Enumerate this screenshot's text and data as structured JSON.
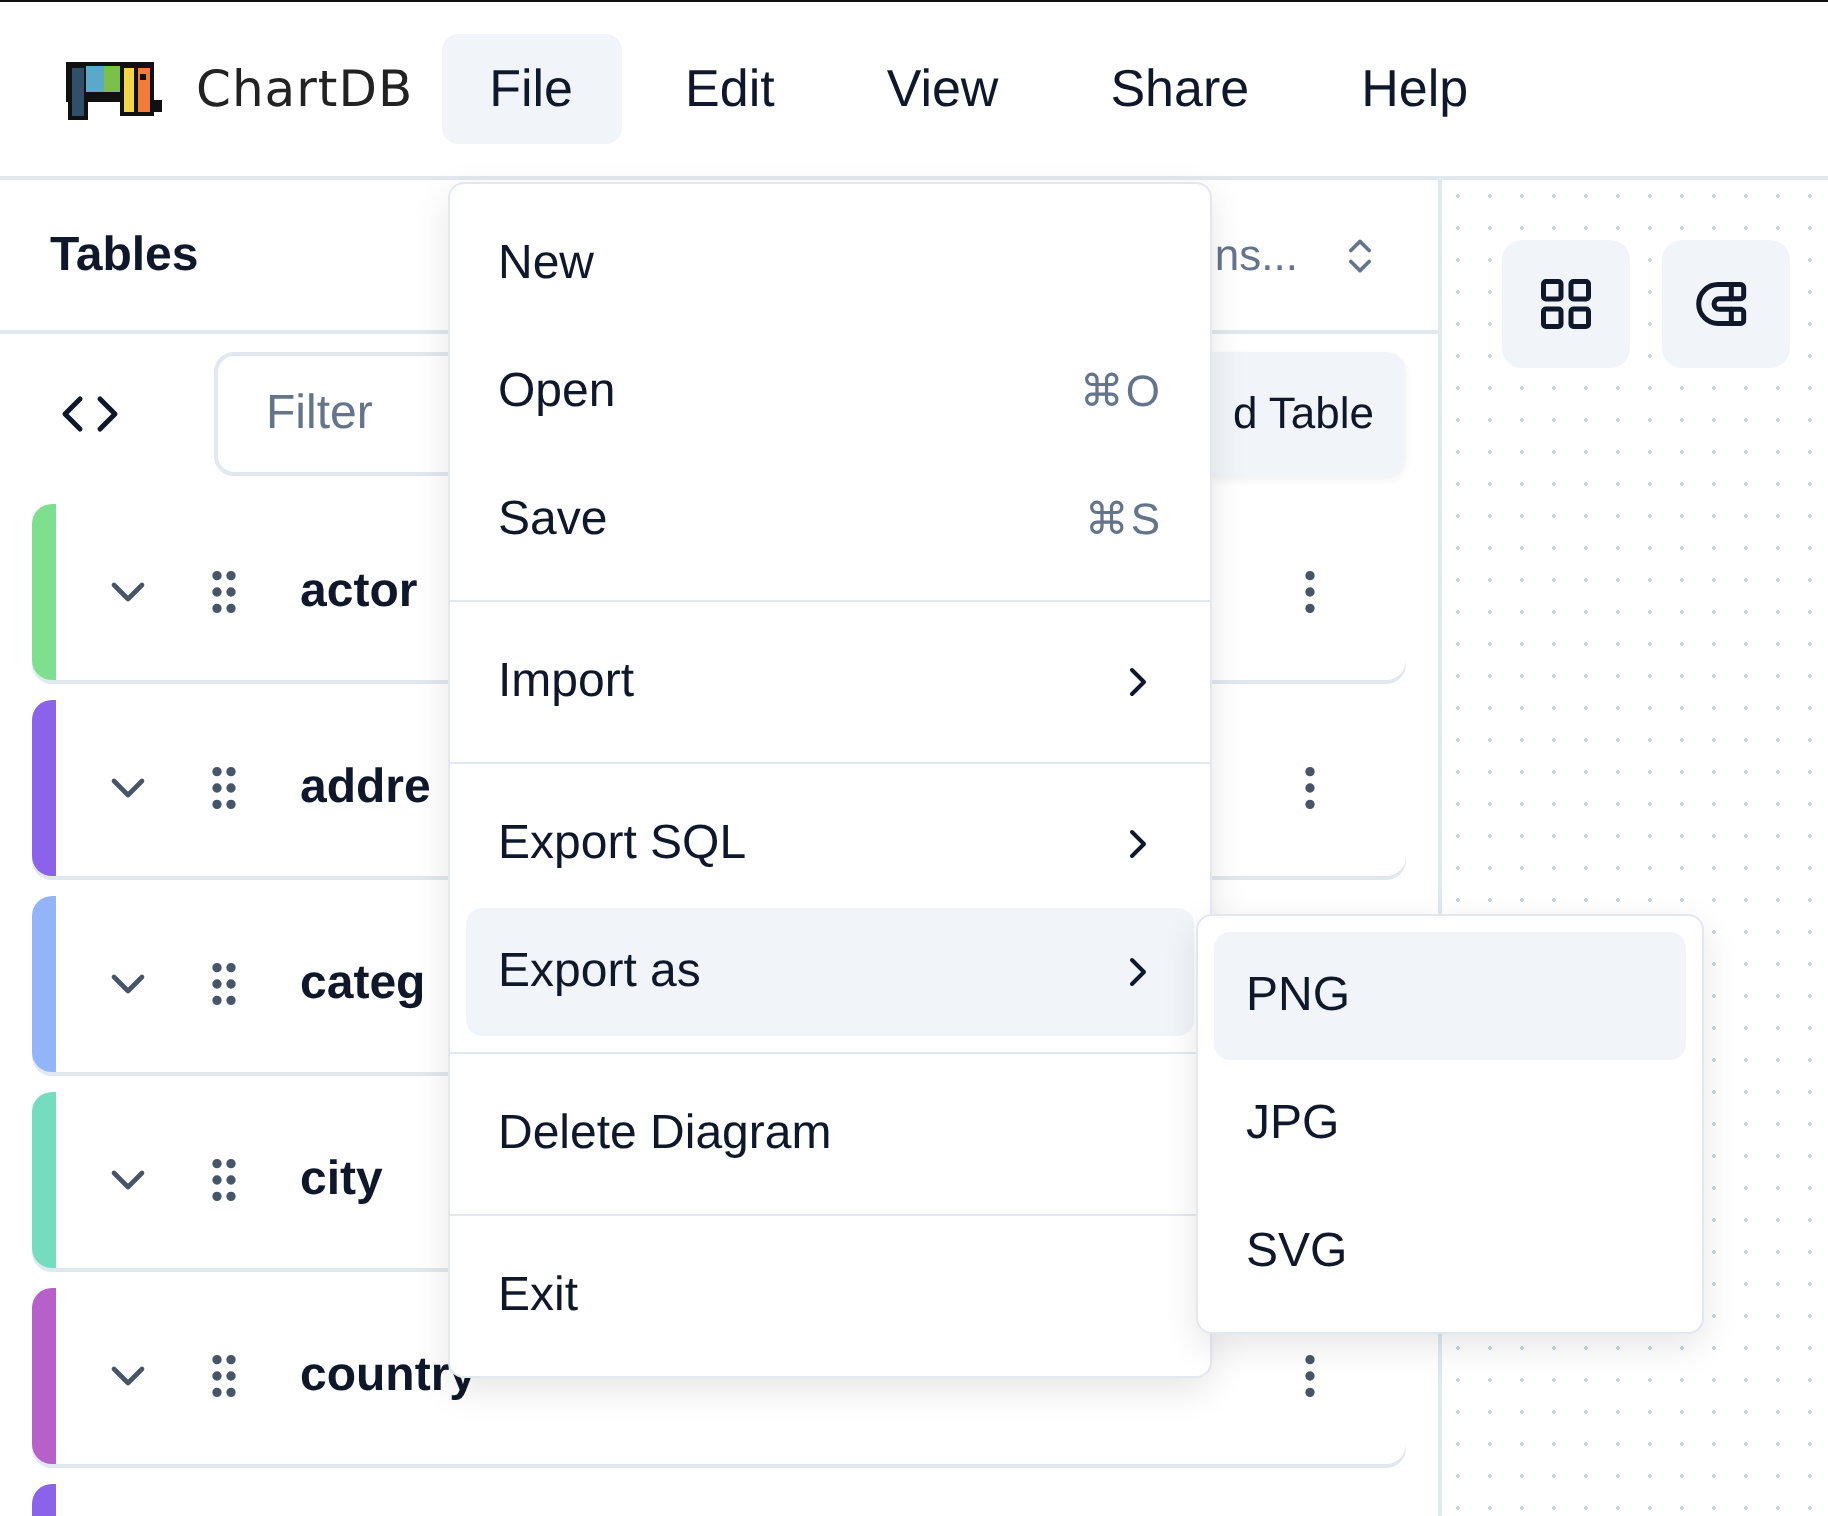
{
  "menubar": {
    "logo_text": "ChartDB",
    "items": [
      {
        "label": "File",
        "selected": true
      },
      {
        "label": "Edit",
        "selected": false
      },
      {
        "label": "View",
        "selected": false
      },
      {
        "label": "Share",
        "selected": false
      },
      {
        "label": "Help",
        "selected": false
      }
    ]
  },
  "sidebar": {
    "title": "Tables",
    "sort_select": "ns...",
    "filter": {
      "placeholder": "Filter"
    },
    "add_button": "d Table",
    "tables": [
      {
        "kind": "row",
        "name": "actor",
        "color": "#7ee08f",
        "menu_button": true
      },
      {
        "kind": "row",
        "name": "addre",
        "color": "#8a63ea",
        "menu_button": true
      },
      {
        "kind": "row",
        "name": "categ",
        "color": "#93b4f8",
        "menu_button": false
      },
      {
        "kind": "row",
        "name": "city",
        "color": "#76dcc0",
        "menu_button": false
      },
      {
        "kind": "row",
        "name": "country",
        "color": "#b660c9",
        "menu_button": true
      },
      {
        "kind": "edge",
        "color": "#8a63ea"
      }
    ]
  },
  "file_menu": {
    "items": [
      {
        "kind": "item",
        "label": "New",
        "selected": false
      },
      {
        "kind": "item",
        "label": "Open",
        "shortcut": "⌘O",
        "selected": false
      },
      {
        "kind": "item",
        "label": "Save",
        "shortcut": "⌘S",
        "selected": false
      },
      {
        "kind": "separator"
      },
      {
        "kind": "submenu",
        "label": "Import",
        "selected": false
      },
      {
        "kind": "separator"
      },
      {
        "kind": "submenu",
        "label": "Export SQL",
        "selected": false
      },
      {
        "kind": "submenu",
        "label": "Export as",
        "selected": true
      },
      {
        "kind": "separator"
      },
      {
        "kind": "item",
        "label": "Delete Diagram",
        "selected": false
      },
      {
        "kind": "separator"
      },
      {
        "kind": "item",
        "label": "Exit",
        "selected": false
      }
    ]
  },
  "export_submenu": {
    "items": [
      {
        "label": "PNG",
        "selected": true
      },
      {
        "label": "JPG",
        "selected": false
      },
      {
        "label": "SVG",
        "selected": false
      }
    ]
  }
}
